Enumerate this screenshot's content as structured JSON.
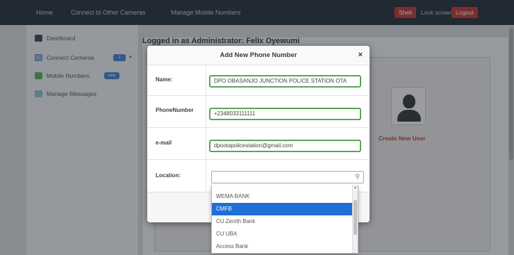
{
  "topbar": {
    "nav": [
      "Home",
      "Connect to Other Cameras",
      "Manage Mobile Numbers"
    ],
    "shell_label": "Shell",
    "lock_label": "Lock screen",
    "logout_label": "Logout"
  },
  "sidebar": {
    "items": [
      {
        "label": "Dashboard",
        "icon": "home-icon"
      },
      {
        "label": "Connect Cameras",
        "icon": "camera-icon",
        "badge": "2"
      },
      {
        "label": "Mobile Numbers",
        "icon": "phone-icon",
        "badge": "new"
      },
      {
        "label": "Manage Messages",
        "icon": "message-icon"
      }
    ]
  },
  "main": {
    "title": "Logged in as Administrator: Felix Oyewumi",
    "create_user": "Create New User"
  },
  "modal": {
    "title": "Add New Phone Number",
    "close": "×",
    "fields": {
      "name": {
        "label": "Name:",
        "value": "DPO OBASANJO JUNCTION POLICE STATION OTA"
      },
      "phone": {
        "label": "PhoneNumber",
        "value": "+2348033111111"
      },
      "email": {
        "label": "e-mail",
        "value": "dpootapolicestation@gmail.com"
      },
      "location": {
        "label": "Location:"
      }
    }
  },
  "dropdown": {
    "search_value": "",
    "options": [
      "WEMA BANK",
      "CMFB",
      "CU Zenith Bank",
      "CU UBA",
      "Access Bank"
    ],
    "selected": "CMFB"
  },
  "colors": {
    "topbar": "#1d2733",
    "accent_red": "#c03128",
    "valid_border": "#5aa35a",
    "selected_option": "#1f6fd6"
  }
}
